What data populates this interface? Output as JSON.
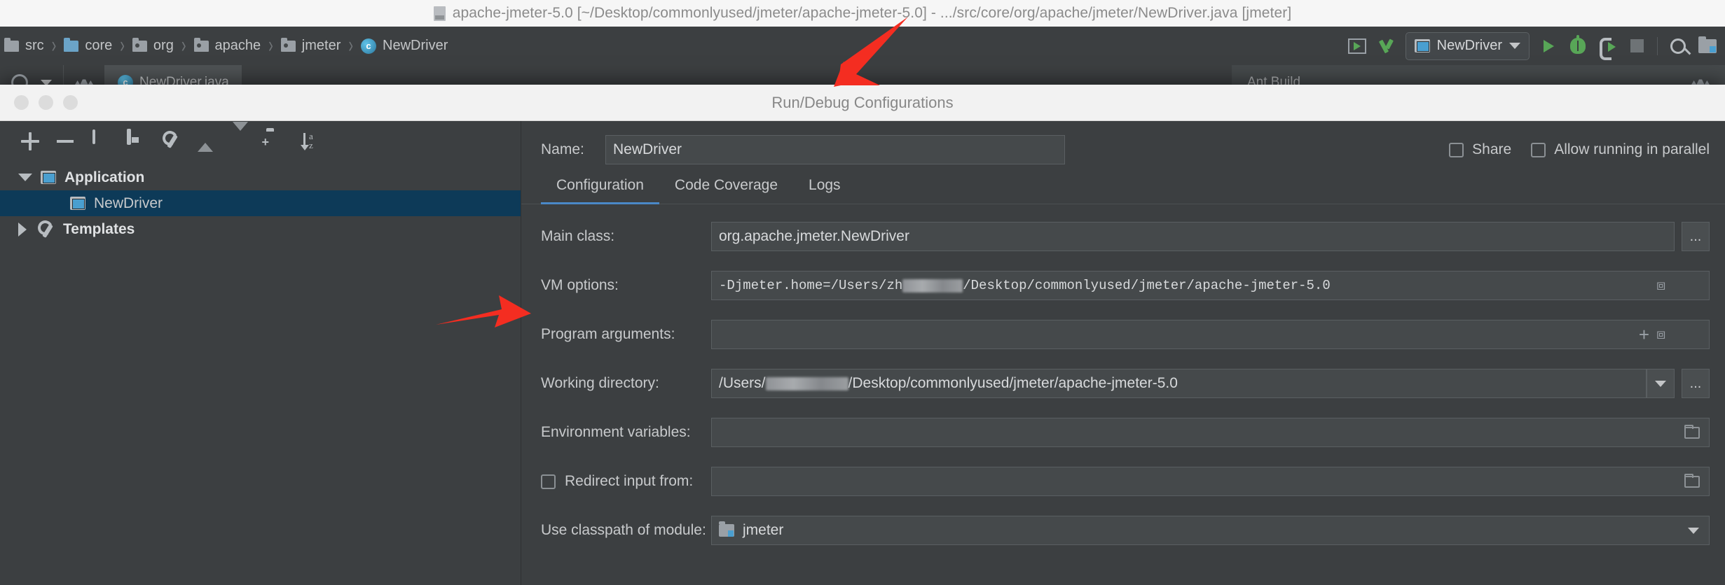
{
  "ide": {
    "title": "apache-jmeter-5.0 [~/Desktop/commonlyused/jmeter/apache-jmeter-5.0] - .../src/core/org/apache/jmeter/NewDriver.java [jmeter]",
    "jar_icon": "jar-file-icon",
    "breadcrumbs": [
      {
        "label": "src",
        "icon": "folder-icon"
      },
      {
        "label": "core",
        "icon": "folder-icon"
      },
      {
        "label": "org",
        "icon": "package-icon"
      },
      {
        "label": "apache",
        "icon": "package-icon"
      },
      {
        "label": "jmeter",
        "icon": "package-icon"
      },
      {
        "label": "NewDriver",
        "icon": "java-class-icon"
      }
    ],
    "separator": "›",
    "toolbar": {
      "run_config_name": "NewDriver",
      "icons": [
        "run-with-coverage-icon",
        "build-project-icon",
        "run-icon",
        "debug-icon",
        "run-with-profiler-icon",
        "stop-icon",
        "search-everywhere-icon",
        "project-structure-icon"
      ]
    },
    "editor_tab": "NewDriver.java",
    "ant_panel": "Ant Build"
  },
  "dialog": {
    "title": "Run/Debug Configurations",
    "window_buttons": [
      "close-button",
      "minimize-button",
      "zoom-button"
    ],
    "left_toolbar": [
      "add-icon",
      "remove-icon",
      "copy-configuration-icon",
      "save-configuration-icon",
      "edit-templates-icon",
      "move-up-icon",
      "move-down-icon",
      "create-folder-icon",
      "sort-alphabetically-icon"
    ],
    "tree": [
      {
        "label": "Application",
        "icon": "application-icon",
        "expanded": true,
        "bold": true,
        "selected": false,
        "level": 0
      },
      {
        "label": "NewDriver",
        "icon": "application-icon",
        "expanded": null,
        "bold": false,
        "selected": true,
        "level": 1
      },
      {
        "label": "Templates",
        "icon": "wrench-icon",
        "expanded": false,
        "bold": true,
        "selected": false,
        "level": 0
      }
    ],
    "name": {
      "label": "Name:",
      "value": "NewDriver"
    },
    "share": {
      "label": "Share",
      "checked": false
    },
    "parallel": {
      "label": "Allow running in parallel",
      "checked": false
    },
    "tabs": [
      {
        "label": "Configuration",
        "active": true
      },
      {
        "label": "Code Coverage",
        "active": false
      },
      {
        "label": "Logs",
        "active": false
      }
    ],
    "fields": {
      "main_class": {
        "label": "Main class:",
        "value": "org.apache.jmeter.NewDriver",
        "browse_button": "..."
      },
      "vm_options": {
        "label": "VM options:",
        "value_prefix": "-Djmeter.home=/Users/zh",
        "value_suffix": "/Desktop/commonlyused/jmeter/apache-jmeter-5.0",
        "redacted": true,
        "expand_icon": "expand-editor-icon"
      },
      "program_arguments": {
        "label": "Program arguments:",
        "value": "",
        "insert_macro_icon": "insert-macro-icon",
        "expand_icon": "expand-editor-icon"
      },
      "working_directory": {
        "label": "Working directory:",
        "value_prefix": "/Users/",
        "value_suffix": "/Desktop/commonlyused/jmeter/apache-jmeter-5.0",
        "redacted": true,
        "dropdown_icon": "chevron-down-icon",
        "browse_button": "..."
      },
      "environment_variables": {
        "label": "Environment variables:",
        "value": "",
        "browse_icon": "browse-folder-icon"
      },
      "redirect_input": {
        "label": "Redirect input from:",
        "checked": false,
        "value": "",
        "browse_icon": "browse-folder-icon"
      },
      "use_classpath": {
        "label": "Use classpath of module:",
        "value": "jmeter",
        "icon": "module-icon",
        "dropdown_icon": "chevron-down-icon"
      }
    }
  },
  "annotations": {
    "arrow_color": "#f42d21",
    "arrows": [
      {
        "name": "arrow-to-run-config-combo"
      },
      {
        "name": "arrow-to-vm-options-field"
      }
    ]
  }
}
